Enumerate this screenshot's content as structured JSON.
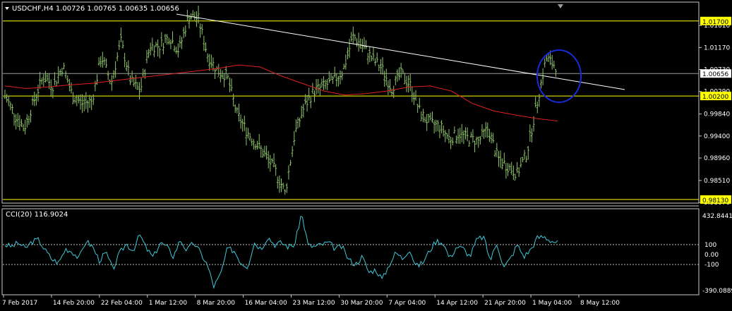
{
  "window": {
    "symbol_line": "USDCHF,H4  1.00726 1.00765 1.00635 1.00656",
    "indicator_line": "CCI(20) 116.9024"
  },
  "colors": {
    "bg": "#000000",
    "frame": "#c8c8c8",
    "bars": "#8fc46a",
    "ma": "#e02020",
    "trend": "#ffffff",
    "hline": "#ffff00",
    "level_line": "#9a9a9a",
    "cci": "#3fc8d8",
    "ellipse": "#1a2ad8",
    "tag_bg": "#ffff00"
  },
  "chart_data": [
    {
      "type": "line",
      "name": "main-price-chart",
      "series": [
        {
          "values": [
            1.002,
            0.9985,
            0.9955,
            1.001,
            1.006,
            1.004,
            1.008,
            1.002,
            1.0005,
            1.001,
            1.01,
            1.0045,
            1.013,
            1.005,
            1.003,
            1.012,
            1.012,
            1.014,
            1.011,
            1.018,
            1.0175,
            1.01,
            1.007,
            1.006,
            0.9985,
            0.995,
            0.9925,
            0.99,
            0.987,
            0.9825,
            0.9945,
            1.0,
            1.003,
            1.004,
            1.005,
            1.007,
            1.014,
            1.012,
            1.0095,
            1.0075,
            1.0035,
            1.0065,
            1.004,
            0.9985,
            0.9965,
            0.996,
            0.9935,
            0.9945,
            0.9935,
            0.993,
            0.9955,
            0.9895,
            0.988,
            0.9865,
            0.9905,
            1.0,
            1.0095,
            1.008
          ]
        },
        {
          "values": [
            1.004,
            1.0035,
            1.0038,
            1.0042,
            1.0045,
            1.005,
            1.0055,
            1.006,
            1.0065,
            1.007,
            1.0075,
            1.0082,
            1.0078,
            1.006,
            1.0045,
            1.003,
            1.0022,
            1.0025,
            1.003,
            1.0038,
            1.004,
            1.003,
            1.0005,
            0.999,
            0.9982,
            0.9975,
            0.997
          ]
        }
      ],
      "horizontal_lines": [
        1.017,
        1.0065,
        1.002,
        0.9813
      ],
      "price_tags": [
        "1.01700",
        "1.00656",
        "1.00200",
        "0.98130"
      ],
      "y_ticks": [
        "1.01610",
        "1.01170",
        "1.00730",
        "1.00290",
        "0.99840",
        "0.99400",
        "0.98960",
        "0.98510",
        "0.98070"
      ],
      "x_ticks": [
        "7 Feb 2017",
        "14 Feb 20:00",
        "22 Feb 04:00",
        "1 Mar 12:00",
        "8 Mar 20:00",
        "16 Mar 04:00",
        "23 Mar 12:00",
        "30 Mar 20:00",
        "7 Apr 04:00",
        "14 Apr 12:00",
        "21 Apr 20:00",
        "1 May 04:00",
        "8 May 12:00"
      ],
      "ylim": [
        0.981,
        1.0188
      ],
      "grid": false
    },
    {
      "type": "line",
      "name": "cci-indicator",
      "series": [
        {
          "values": [
            100,
            80,
            120,
            60,
            130,
            150,
            40,
            -50,
            -80,
            60,
            30,
            -40,
            140,
            80,
            -60,
            20,
            -150,
            10,
            110,
            40,
            200,
            60,
            -30,
            120,
            80,
            -20,
            150,
            40,
            120,
            20,
            -100,
            -320,
            -200,
            60,
            40,
            -80,
            -120,
            120,
            60,
            180,
            100,
            120,
            80,
            100,
            420,
            90,
            80,
            100,
            120,
            60,
            80,
            -50,
            -100,
            -20,
            -180,
            -150,
            -250,
            -100,
            20,
            -40,
            60,
            -120,
            -80,
            40,
            140,
            120,
            -40,
            80,
            60,
            -20,
            150,
            180,
            -60,
            120,
            -130,
            -40,
            100,
            -20,
            50,
            170,
            180,
            140,
            120
          ]
        }
      ],
      "levels": [
        "100",
        "0.00",
        "-100"
      ],
      "range_labels": [
        "432.8441",
        "-390.0889"
      ],
      "ylim": [
        -390.0889,
        432.8441
      ]
    }
  ]
}
